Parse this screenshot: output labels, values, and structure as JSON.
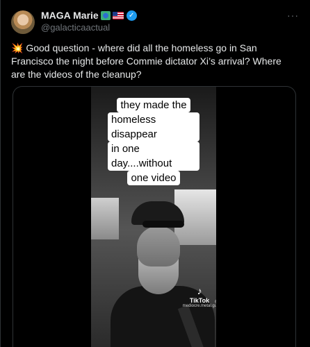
{
  "user": {
    "name": "MAGA Marie",
    "handle": "@galacticaactual",
    "verified_mark": "✓",
    "flags": [
      "globe-flag",
      "us-flag"
    ]
  },
  "menu": {
    "more_label": "···"
  },
  "tweet": {
    "emoji": "💥",
    "text": "Good question - where did all the homeless go in San Francisco the night before Commie dictator Xi’s arrival? Where are the videos of the cleanup?"
  },
  "media": {
    "caption_lines": [
      "they made the",
      "homeless disappear",
      "in one day....without",
      "one video"
    ],
    "tiktok_label": "TikTok",
    "tiktok_user": "@ mediocre.metal.guy"
  },
  "colors": {
    "background": "#000000",
    "text_primary": "#e7e9ea",
    "text_secondary": "#71767b",
    "verified": "#1d9bf0",
    "border": "#2f3336"
  }
}
